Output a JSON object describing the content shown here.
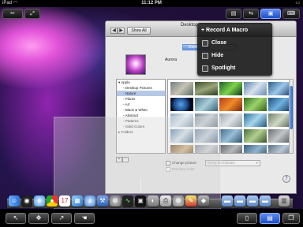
{
  "status_bar": {
    "carrier": "iPad",
    "wifi_icon": "wifi-icon",
    "time": "11:12 PM",
    "battery_icon": "battery-icon"
  },
  "desktop_window": {
    "title": "Desktop",
    "show_all_label": "Show All",
    "tabs": [
      {
        "label": "Desktop",
        "active": true
      },
      {
        "label": "",
        "active": false
      }
    ],
    "current_picture_name": "Aurora",
    "source_list": [
      {
        "label": "Apple",
        "level": 0,
        "selected": false
      },
      {
        "label": "Desktop Pictures",
        "level": 1,
        "selected": false
      },
      {
        "label": "Nature",
        "level": 1,
        "selected": true
      },
      {
        "label": "Plants",
        "level": 1,
        "selected": false
      },
      {
        "label": "Art",
        "level": 1,
        "selected": false
      },
      {
        "label": "Black & White",
        "level": 1,
        "selected": false
      },
      {
        "label": "Abstract",
        "level": 1,
        "selected": false
      },
      {
        "label": "Patterns",
        "level": 1,
        "selected": false
      },
      {
        "label": "Solid Colors",
        "level": 1,
        "selected": false
      },
      {
        "label": "Folders",
        "level": 0,
        "selected": false
      }
    ],
    "add_label": "+",
    "remove_label": "-",
    "change_picture_label": "Change picture:",
    "change_interval": "Every 30 minutes",
    "random_order_label": "Random order",
    "help_label": "?"
  },
  "macro_menu": {
    "items": [
      {
        "label": "+ Record A Macro",
        "icon": ""
      },
      {
        "label": "Close",
        "icon": "macro-icon"
      },
      {
        "label": "Hide",
        "icon": "macro-icon"
      },
      {
        "label": "Spotlight",
        "icon": "macro-icon"
      }
    ]
  },
  "colors": {
    "accent": "#2f66d0",
    "menu_bg": "#1e1e1e",
    "selection": "#b7c8e6"
  }
}
